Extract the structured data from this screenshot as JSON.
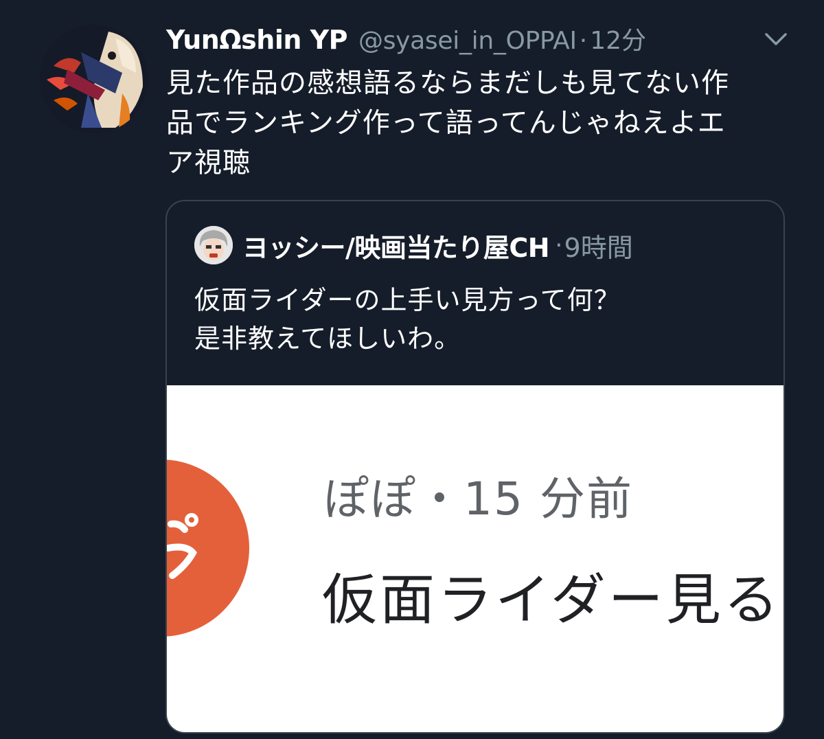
{
  "tweet": {
    "display_name": "YunΩshin YP",
    "handle": "@syasei_in_OPPAI",
    "separator": "·",
    "time": "12分",
    "text_lines": [
      "見た作品の感想語るならまだしも見てない作",
      "品でランキング作って語ってんじゃねえよエ",
      "ア視聴"
    ],
    "menu_icon": "chevron-down-icon"
  },
  "quoted_tweet": {
    "display_name": "ヨッシー/映画当たり屋CH",
    "separator": "·",
    "time": "9時間",
    "text_lines": [
      "仮面ライダーの上手い見方って何？",
      "是非教えてほしいわ。"
    ],
    "image": {
      "avatar_color": "#e4603a",
      "meta": "ぽぽ・15 分前",
      "title": "仮面ライダー見る"
    }
  },
  "colors": {
    "background": "#161d2a",
    "secondary_text": "#8899a6",
    "border": "#38444d"
  }
}
